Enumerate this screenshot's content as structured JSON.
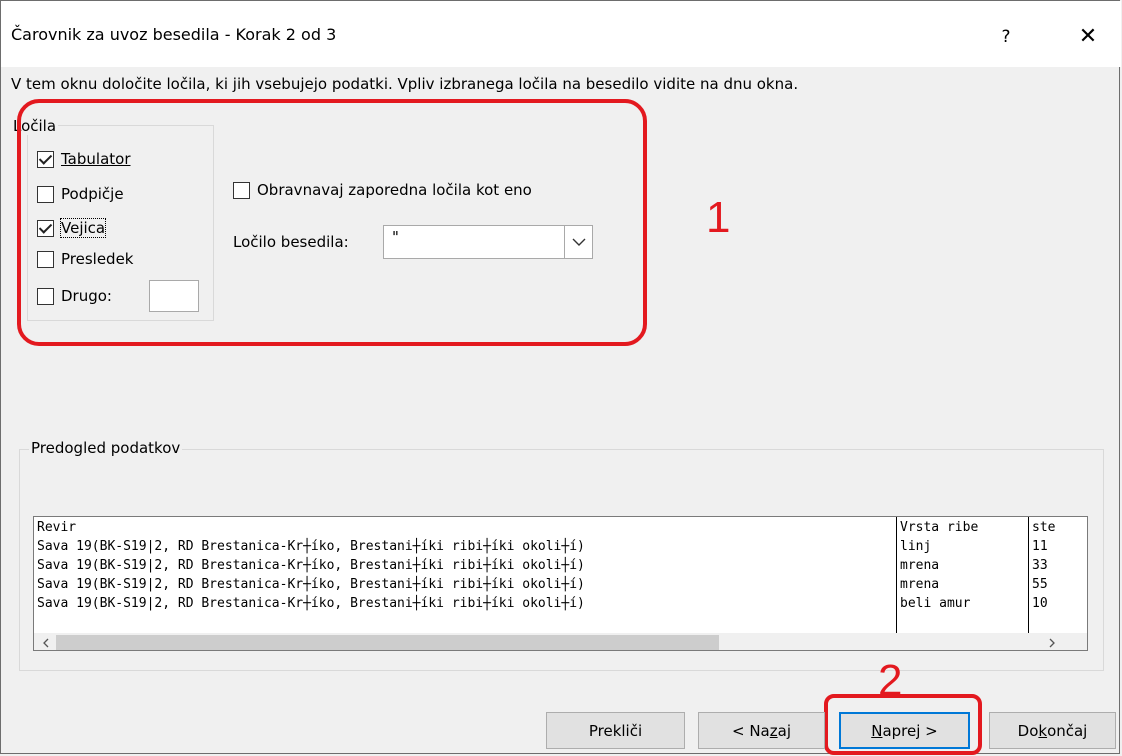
{
  "window": {
    "title": "Čarovnik za uvoz besedila - Korak 2 od 3",
    "help_label": "?",
    "close_label": "✕"
  },
  "instructions": "V tem oknu določite ločila, ki jih vsebujejo podatki. Vpliv izbranega ločila na besedilo vidite na dnu okna.",
  "delimiters": {
    "legend": "Ločila",
    "tab": {
      "label": "Tabulator",
      "checked": true
    },
    "semicolon": {
      "label": "Podpičje",
      "checked": false
    },
    "comma": {
      "label": "Vejica",
      "checked": true
    },
    "space": {
      "label": "Presledek",
      "checked": false
    },
    "other": {
      "label": "Drugo:",
      "checked": false,
      "value": ""
    }
  },
  "consecutive": {
    "label": "Obravnavaj zaporedna ločila kot eno",
    "checked": false
  },
  "text_qualifier": {
    "label": "Ločilo besedila:",
    "value": "\""
  },
  "annotations": {
    "one": "1",
    "two": "2"
  },
  "preview": {
    "legend": "Predogled podatkov",
    "rows": [
      [
        "Revir",
        "Vrsta ribe",
        "ste"
      ],
      [
        "Sava 19(BK-S19|2, RD Brestanica-Kr┼íko, Brestani┼íki ribi┼íki okoli┼í)",
        "linj",
        "11"
      ],
      [
        "Sava 19(BK-S19|2, RD Brestanica-Kr┼íko, Brestani┼íki ribi┼íki okoli┼í)",
        "mrena",
        "33"
      ],
      [
        "Sava 19(BK-S19|2, RD Brestanica-Kr┼íko, Brestani┼íki ribi┼íki okoli┼í)",
        "mrena",
        "55"
      ],
      [
        "Sava 19(BK-S19|2, RD Brestanica-Kr┼íko, Brestani┼íki ribi┼íki okoli┼í)",
        "beli amur",
        "10"
      ]
    ]
  },
  "buttons": {
    "cancel": "Prekliči",
    "back": "< Nazaj",
    "next": "Naprej >",
    "finish": "Dokončaj"
  },
  "colors": {
    "annotation": "#e3191f",
    "focus_border": "#0078d7"
  }
}
